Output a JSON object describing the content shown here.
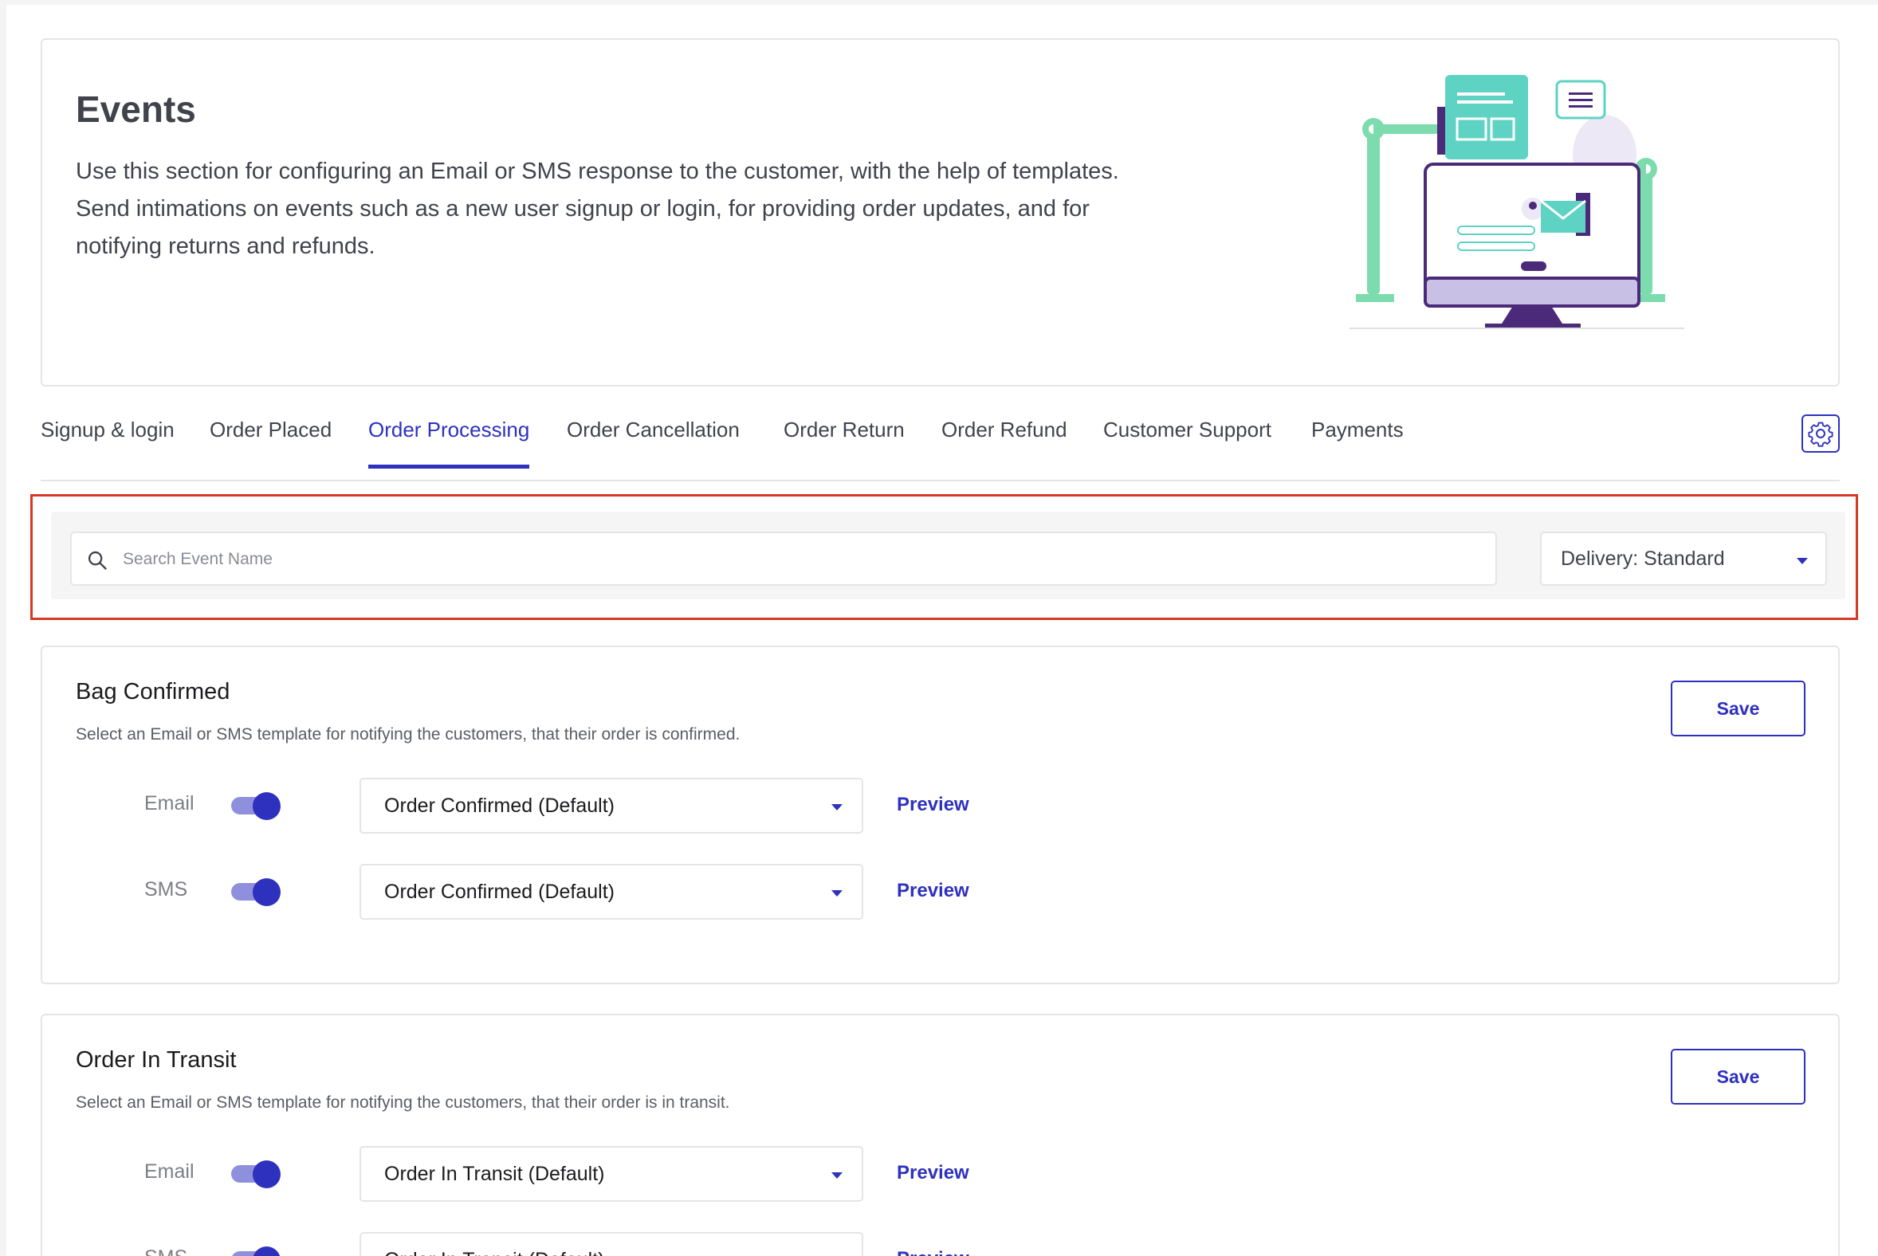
{
  "hero": {
    "title": "Events",
    "description_lines": [
      "Use this section for configuring an Email or SMS response to the customer, with the help of templates.",
      "Send intimations on events such as a new user signup or login, for providing order updates, and for",
      "notifying returns and refunds."
    ]
  },
  "tabs": [
    {
      "label": "Signup & login",
      "active": false
    },
    {
      "label": "Order Placed",
      "active": false
    },
    {
      "label": "Order Processing",
      "active": true
    },
    {
      "label": "Order Cancellation",
      "active": false
    },
    {
      "label": "Order Return",
      "active": false
    },
    {
      "label": "Order Refund",
      "active": false
    },
    {
      "label": "Customer Support",
      "active": false
    },
    {
      "label": "Payments",
      "active": false
    }
  ],
  "settings_icon": "gear-icon",
  "filter": {
    "search_placeholder": "Search Event Name",
    "search_value": "",
    "delivery_value": "Delivery: Standard"
  },
  "events": [
    {
      "title": "Bag Confirmed",
      "description": "Select an Email or SMS template for notifying the customers, that their order is confirmed.",
      "save_label": "Save",
      "channels": [
        {
          "label": "Email",
          "enabled": true,
          "template": "Order Confirmed (Default)",
          "preview_label": "Preview"
        },
        {
          "label": "SMS",
          "enabled": true,
          "template": "Order Confirmed (Default)",
          "preview_label": "Preview"
        }
      ]
    },
    {
      "title": "Order In Transit",
      "description": "Select an Email or SMS template for notifying the customers, that their order is in transit.",
      "save_label": "Save",
      "channels": [
        {
          "label": "Email",
          "enabled": true,
          "template": "Order In Transit (Default)",
          "preview_label": "Preview"
        },
        {
          "label": "SMS",
          "enabled": true,
          "template": "Order In Transit (Default)",
          "preview_label": "Preview"
        }
      ]
    }
  ],
  "colors": {
    "accent": "#2e31be",
    "highlight": "#d43a25",
    "toggle_track": "#8e90dd",
    "illustration_green": "#7ddcae",
    "illustration_teal": "#5ed3c4",
    "illustration_purple": "#4b2a7a"
  }
}
